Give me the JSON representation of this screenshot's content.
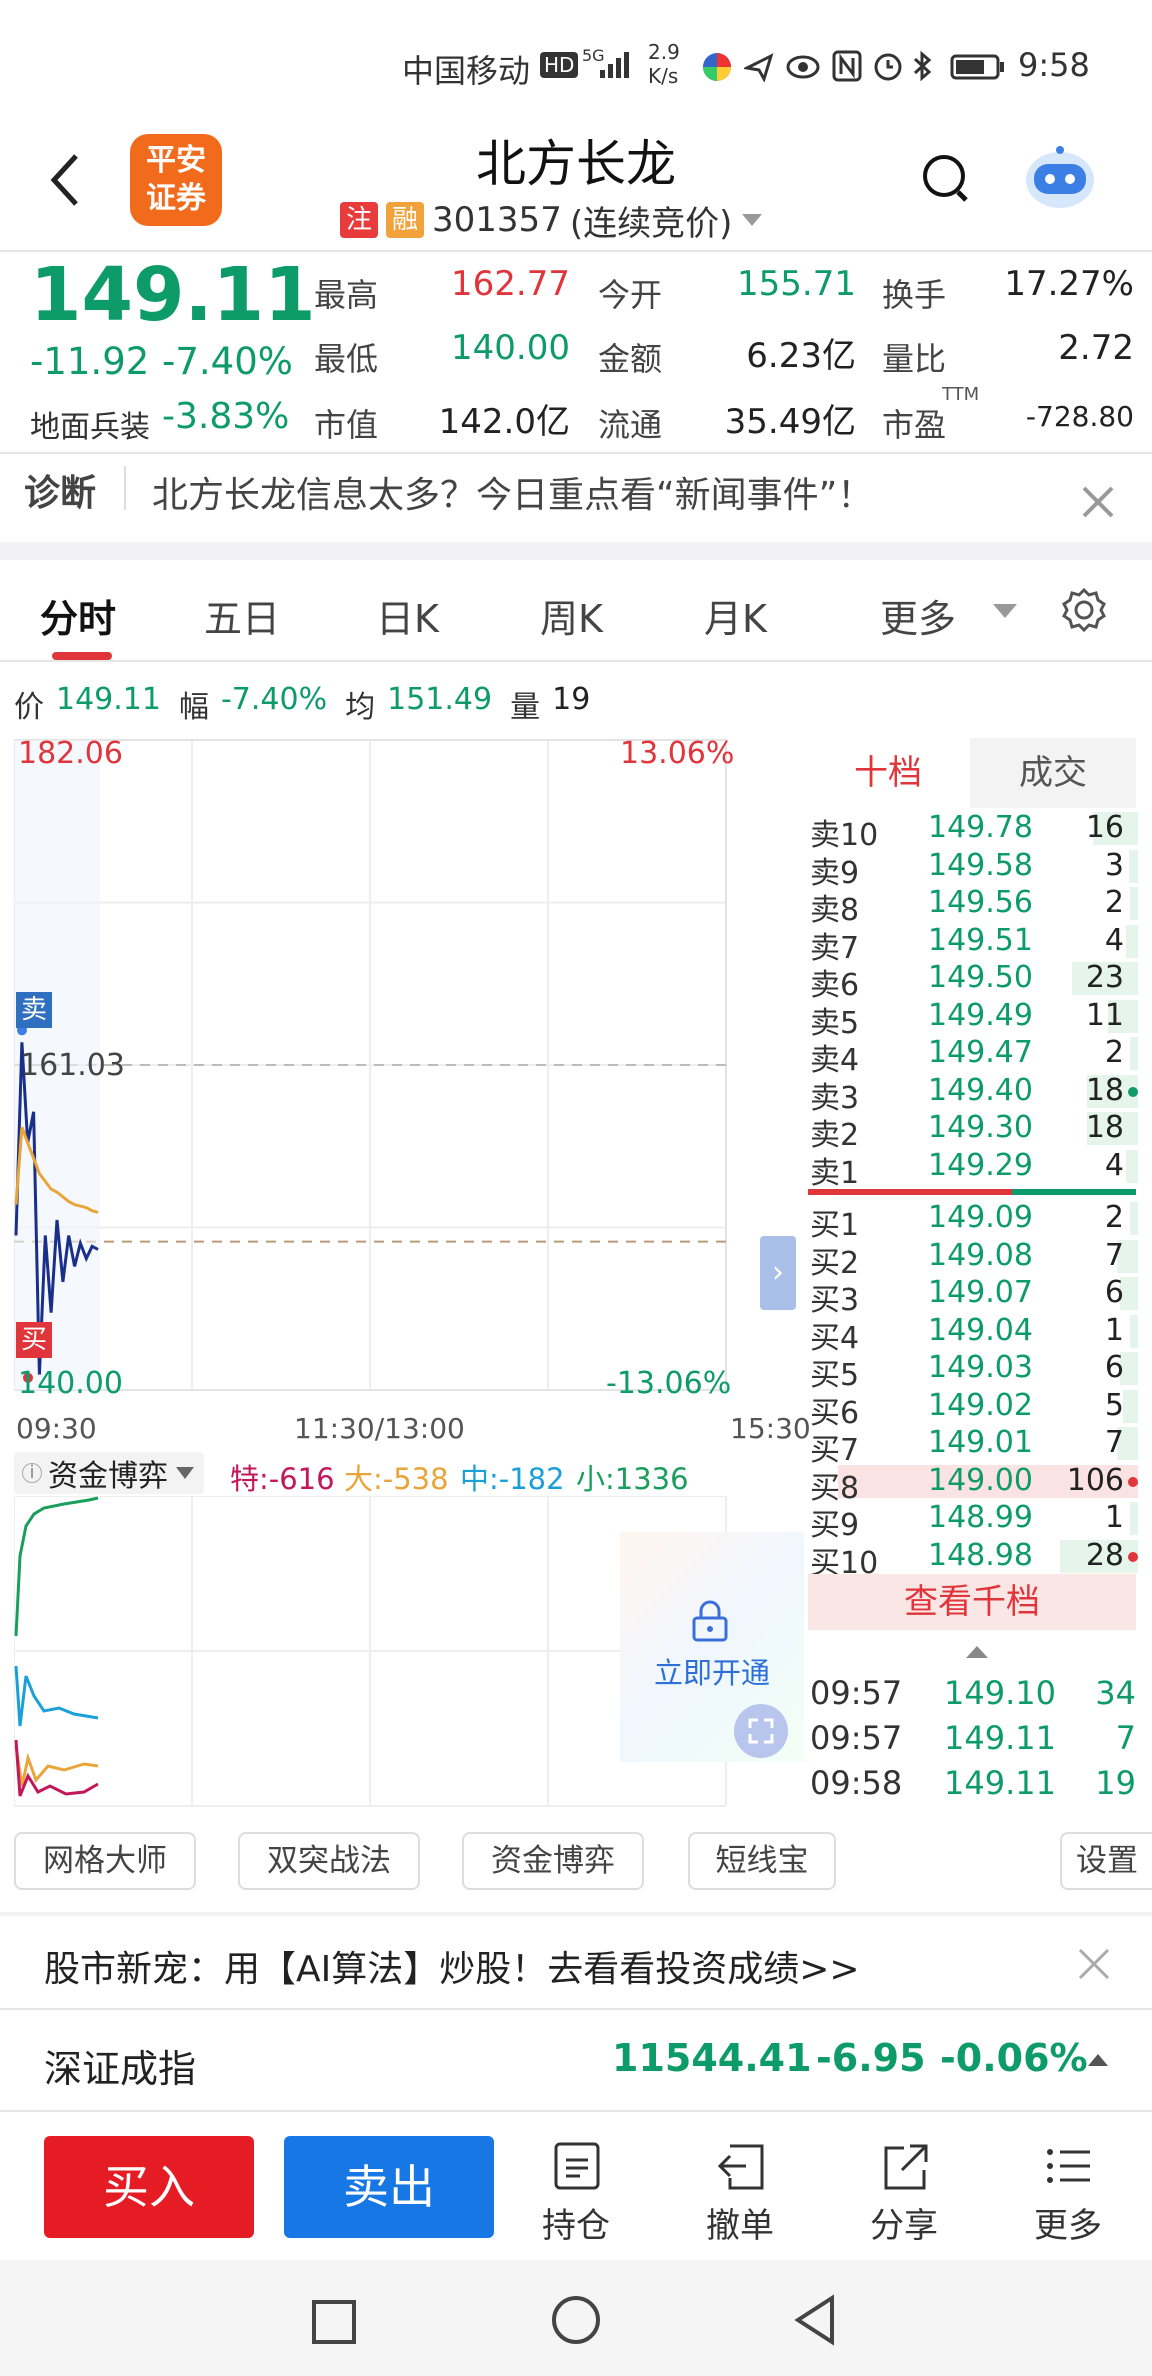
{
  "status_bar": {
    "carrier": "中国移动",
    "hd": "HD",
    "signal": "5G",
    "net_speed_top": "2.9",
    "net_speed_bottom": "K/s",
    "time": "9:58"
  },
  "header": {
    "logo_line1": "平安",
    "logo_line2": "证券",
    "title": "北方长龙",
    "tag_zhu": "注",
    "tag_rong": "融",
    "code": "301357",
    "trade_mode": "(连续竞价)"
  },
  "quote": {
    "price": "149.11",
    "change": "-11.92",
    "change_pct": "-7.40%",
    "sector": "地面兵装",
    "sector_pct": "-3.83%",
    "cells": [
      {
        "label": "最高",
        "value": "162.77",
        "color": "red"
      },
      {
        "label": "今开",
        "value": "155.71",
        "color": "green"
      },
      {
        "label": "换手",
        "value": "17.27%",
        "color": "dark"
      },
      {
        "label": "最低",
        "value": "140.00",
        "color": "green"
      },
      {
        "label": "金额",
        "value": "6.23亿",
        "color": "dark"
      },
      {
        "label": "量比",
        "value": "2.72",
        "color": "dark"
      },
      {
        "label": "市值",
        "value": "142.0亿",
        "color": "dark"
      },
      {
        "label": "流通",
        "value": "35.49亿",
        "color": "dark"
      },
      {
        "label": "市盈",
        "value": "-728.80",
        "color": "dark"
      }
    ],
    "ttm": "TTM"
  },
  "diagnosis": {
    "label": "诊断",
    "text": "北方长龙信息太多？今日重点看“新闻事件”！"
  },
  "tabs": [
    "分时",
    "五日",
    "日K",
    "周K",
    "月K",
    "更多"
  ],
  "chart_info": {
    "price_label": "价",
    "price": "149.11",
    "amp_label": "幅",
    "amp": "-7.40%",
    "avg_label": "均",
    "avg": "151.49",
    "vol_label": "量",
    "vol": "19"
  },
  "chart_data": {
    "type": "line",
    "y_max_label": "182.06",
    "y_mid_label": "161.03",
    "y_min_label": "140.00",
    "pct_max_label": "13.06%",
    "pct_min_label": "-13.06%",
    "x_labels": [
      "09:30",
      "11:30/13:00",
      "15:30"
    ],
    "sell_marker": "卖",
    "buy_marker": "买",
    "ylim": [
      140.0,
      182.06
    ],
    "series": [
      {
        "values": [
          150,
          162.5,
          156,
          158,
          141,
          150,
          145,
          151,
          147,
          150,
          148,
          149.5,
          148.5,
          149.3,
          149.1
        ]
      },
      {
        "values": [
          152,
          157,
          156,
          155,
          154,
          153.5,
          153,
          152.8,
          152.5,
          152.2,
          152,
          151.9,
          151.8,
          151.6,
          151.49
        ]
      }
    ]
  },
  "capital_game": {
    "title": "资金博弈",
    "te": "特:-616",
    "da": "大:-538",
    "zhong": "中:-182",
    "xiao": "小:1336",
    "unlock": "立即开通"
  },
  "order_book": {
    "tab_ten": "十档",
    "tab_deal": "成交",
    "asks": [
      {
        "label": "卖10",
        "price": "149.78",
        "vol": "16",
        "w": 0.15
      },
      {
        "label": "卖9",
        "price": "149.58",
        "vol": "3",
        "w": 0.03
      },
      {
        "label": "卖8",
        "price": "149.56",
        "vol": "2",
        "w": 0.02
      },
      {
        "label": "卖7",
        "price": "149.51",
        "vol": "4",
        "w": 0.04
      },
      {
        "label": "卖6",
        "price": "149.50",
        "vol": "23",
        "w": 0.22
      },
      {
        "label": "卖5",
        "price": "149.49",
        "vol": "11",
        "w": 0.1
      },
      {
        "label": "卖4",
        "price": "149.47",
        "vol": "2",
        "w": 0.02
      },
      {
        "label": "卖3",
        "price": "149.40",
        "vol": "18",
        "w": 0.17
      },
      {
        "label": "卖2",
        "price": "149.30",
        "vol": "18",
        "w": 0.17
      },
      {
        "label": "卖1",
        "price": "149.29",
        "vol": "4",
        "w": 0.04
      }
    ],
    "bids": [
      {
        "label": "买1",
        "price": "149.09",
        "vol": "2",
        "w": 0.02
      },
      {
        "label": "买2",
        "price": "149.08",
        "vol": "7",
        "w": 0.07
      },
      {
        "label": "买3",
        "price": "149.07",
        "vol": "6",
        "w": 0.06
      },
      {
        "label": "买4",
        "price": "149.04",
        "vol": "1",
        "w": 0.01
      },
      {
        "label": "买5",
        "price": "149.03",
        "vol": "6",
        "w": 0.06
      },
      {
        "label": "买6",
        "price": "149.02",
        "vol": "5",
        "w": 0.05
      },
      {
        "label": "买7",
        "price": "149.01",
        "vol": "7",
        "w": 0.07
      },
      {
        "label": "买8",
        "price": "149.00",
        "vol": "106",
        "w": 1.0
      },
      {
        "label": "买9",
        "price": "148.99",
        "vol": "1",
        "w": 0.01
      },
      {
        "label": "买10",
        "price": "148.98",
        "vol": "28",
        "w": 0.26
      }
    ],
    "view_more": "查看千档",
    "trades": [
      {
        "time": "09:57",
        "price": "149.10",
        "vol": "34"
      },
      {
        "time": "09:57",
        "price": "149.11",
        "vol": "7"
      },
      {
        "time": "09:58",
        "price": "149.11",
        "vol": "19"
      }
    ]
  },
  "tools": [
    "网格大师",
    "双突战法",
    "资金博弈",
    "短线宝"
  ],
  "tools_settings": "设置",
  "promo": "股市新宠：用【AI算法】炒股！去看看投资成绩>>",
  "index": {
    "name": "深证成指",
    "value": "11544.41",
    "change": "-6.95",
    "pct": "-0.06%"
  },
  "actions": {
    "buy": "买入",
    "sell": "卖出",
    "position": "持仓",
    "cancel": "撤单",
    "share": "分享",
    "more": "更多"
  },
  "colors": {
    "up": "#e0353b",
    "down": "#0e9b6a",
    "buy_button": "#e51c23",
    "sell_button": "#1677e5",
    "price_line": "#1a2f8a",
    "avg_line": "#e8a63a"
  }
}
